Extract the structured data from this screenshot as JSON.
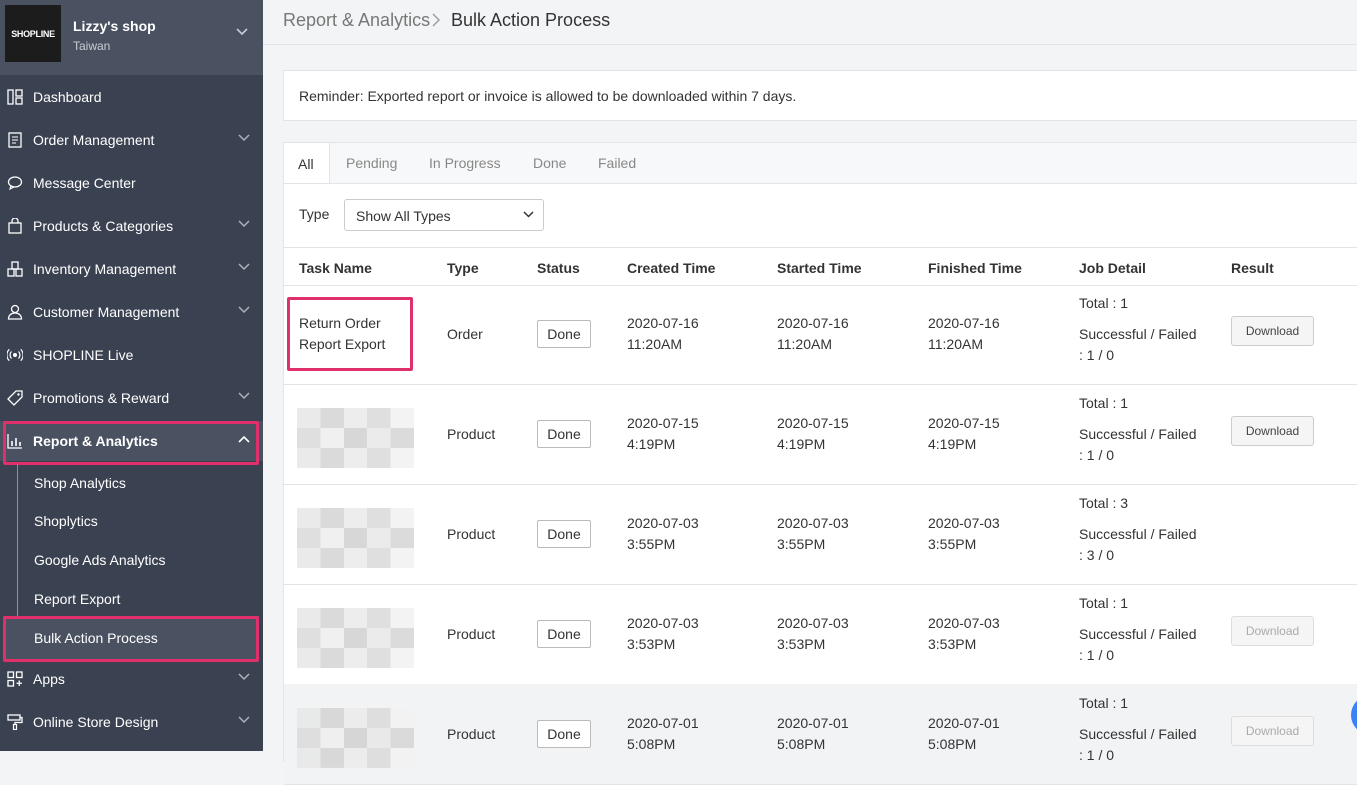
{
  "shop": {
    "logo": "SHOPLINE",
    "name": "Lizzy's shop",
    "region": "Taiwan"
  },
  "sidebar": {
    "items": [
      {
        "label": "Dashboard"
      },
      {
        "label": "Order Management"
      },
      {
        "label": "Message Center"
      },
      {
        "label": "Products & Categories"
      },
      {
        "label": "Inventory Management"
      },
      {
        "label": "Customer Management"
      },
      {
        "label": "SHOPLINE Live"
      },
      {
        "label": "Promotions & Reward"
      },
      {
        "label": "Report & Analytics"
      },
      {
        "label": "Apps"
      },
      {
        "label": "Online Store Design"
      }
    ],
    "sub_items": [
      {
        "label": "Shop Analytics"
      },
      {
        "label": "Shoplytics"
      },
      {
        "label": "Google Ads Analytics"
      },
      {
        "label": "Report Export"
      },
      {
        "label": "Bulk Action Process"
      }
    ]
  },
  "breadcrumb": {
    "root": "Report & Analytics",
    "current": "Bulk Action Process"
  },
  "reminder": "Reminder: Exported report or invoice is allowed to be downloaded within 7 days.",
  "tabs": [
    "All",
    "Pending",
    "In Progress",
    "Done",
    "Failed"
  ],
  "filter": {
    "label": "Type",
    "value": "Show All Types"
  },
  "table": {
    "headers": [
      "Task Name",
      "Type",
      "Status",
      "Created Time",
      "Started Time",
      "Finished Time",
      "Job Detail",
      "Result"
    ],
    "rows": [
      {
        "task_line1": "Return Order",
        "task_line2": "Report Export",
        "type": "Order",
        "status": "Done",
        "created_date": "2020-07-16",
        "created_time": "11:20AM",
        "started_date": "2020-07-16",
        "started_time": "11:20AM",
        "finished_date": "2020-07-16",
        "finished_time": "11:20AM",
        "total": "Total : 1",
        "sf_label": "Successful / Failed",
        "sf_value": ": 1 / 0",
        "result": "Download"
      },
      {
        "type": "Product",
        "status": "Done",
        "created_date": "2020-07-15",
        "created_time": "4:19PM",
        "started_date": "2020-07-15",
        "started_time": "4:19PM",
        "finished_date": "2020-07-15",
        "finished_time": "4:19PM",
        "total": "Total : 1",
        "sf_label": "Successful / Failed",
        "sf_value": ": 1 / 0",
        "result": "Download"
      },
      {
        "type": "Product",
        "status": "Done",
        "created_date": "2020-07-03",
        "created_time": "3:55PM",
        "started_date": "2020-07-03",
        "started_time": "3:55PM",
        "finished_date": "2020-07-03",
        "finished_time": "3:55PM",
        "total": "Total : 3",
        "sf_label": "Successful / Failed",
        "sf_value": ": 3 / 0",
        "result": ""
      },
      {
        "type": "Product",
        "status": "Done",
        "created_date": "2020-07-03",
        "created_time": "3:53PM",
        "started_date": "2020-07-03",
        "started_time": "3:53PM",
        "finished_date": "2020-07-03",
        "finished_time": "3:53PM",
        "total": "Total : 1",
        "sf_label": "Successful / Failed",
        "sf_value": ": 1 / 0",
        "result": "Download"
      },
      {
        "type": "Product",
        "status": "Done",
        "created_date": "2020-07-01",
        "created_time": "5:08PM",
        "started_date": "2020-07-01",
        "started_time": "5:08PM",
        "finished_date": "2020-07-01",
        "finished_time": "5:08PM",
        "total": "Total : 1",
        "sf_label": "Successful / Failed",
        "sf_value": ": 1 / 0",
        "result": "Download"
      }
    ]
  },
  "colors": {
    "sidebar": "#3a4150",
    "highlight": "#e0306c",
    "accent": "#3b82f6"
  }
}
